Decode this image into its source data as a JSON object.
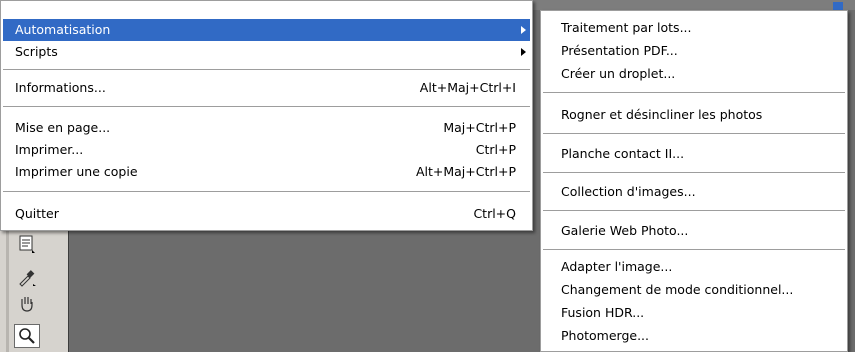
{
  "main_menu": {
    "items": [
      {
        "label": "Automatisation",
        "shortcut": "",
        "submenu": true
      },
      {
        "label": "Scripts",
        "shortcut": "",
        "submenu": true
      },
      {
        "label": "Informations...",
        "shortcut": "Alt+Maj+Ctrl+I"
      },
      {
        "label": "Mise en page...",
        "shortcut": "Maj+Ctrl+P"
      },
      {
        "label": "Imprimer...",
        "shortcut": "Ctrl+P"
      },
      {
        "label": "Imprimer une copie",
        "shortcut": "Alt+Maj+Ctrl+P"
      },
      {
        "label": "Quitter",
        "shortcut": "Ctrl+Q"
      }
    ]
  },
  "submenu": {
    "items": [
      {
        "label": "Traitement par lots..."
      },
      {
        "label": "Présentation PDF..."
      },
      {
        "label": "Créer un droplet..."
      },
      {
        "label": "Rogner et désincliner les photos"
      },
      {
        "label": "Planche contact II..."
      },
      {
        "label": "Collection d'images..."
      },
      {
        "label": "Galerie Web Photo..."
      },
      {
        "label": "Adapter l'image..."
      },
      {
        "label": "Changement de mode conditionnel..."
      },
      {
        "label": "Fusion HDR..."
      },
      {
        "label": "Photomerge..."
      }
    ]
  },
  "toolbox": {
    "tools": [
      "notes-icon",
      "eyedropper-icon",
      "hand-icon",
      "zoom-icon"
    ],
    "active_tool": "zoom-icon"
  },
  "colors": {
    "highlight": "#316ac5",
    "workspace": "#6e6e6e",
    "toolbox": "#d6d3ce"
  }
}
